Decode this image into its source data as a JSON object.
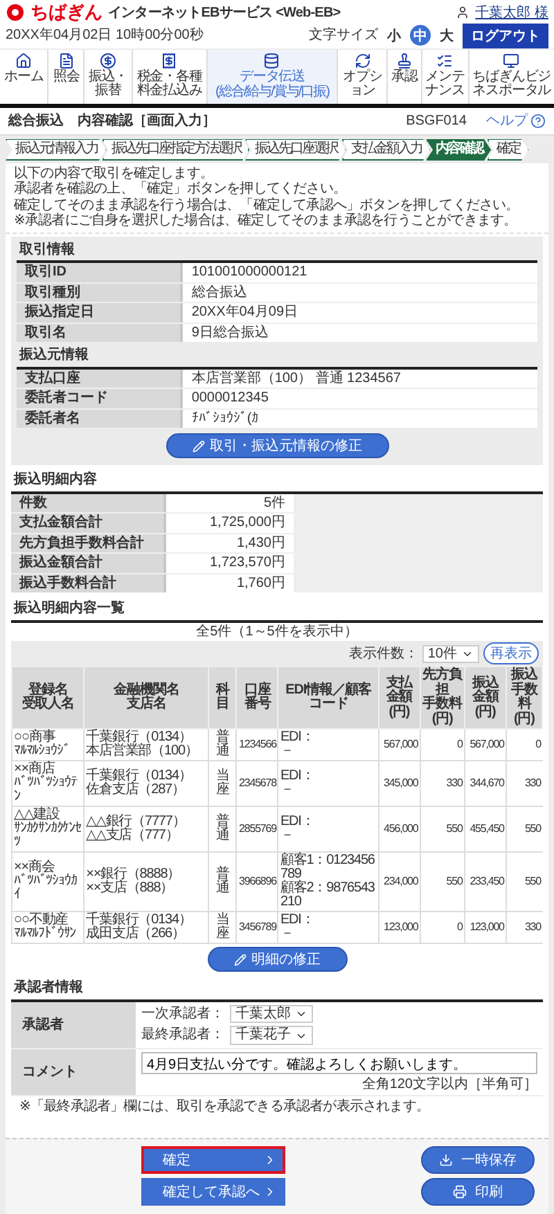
{
  "header": {
    "logo": "ちばぎん",
    "service": "インターネットEBサービス <Web-EB>",
    "user": "千葉太郎 様",
    "datetime": "20XX年04月02日 10時00分00秒",
    "font_size_label": "文字サイズ",
    "font_sizes": [
      {
        "label": "小",
        "selected": false
      },
      {
        "label": "中",
        "selected": true
      },
      {
        "label": "大",
        "selected": false
      }
    ],
    "logout": "ログアウト"
  },
  "nav": [
    {
      "label": "ホーム",
      "selected": false
    },
    {
      "label": "照会",
      "selected": false
    },
    {
      "label": "振込・振替",
      "selected": false
    },
    {
      "label": "税金・各種料金払込み",
      "selected": false
    },
    {
      "label": "データ伝送",
      "sub": "(総合/給与/賞与/口振)",
      "selected": true
    },
    {
      "label": "オプション",
      "selected": false
    },
    {
      "label": "承認",
      "selected": false
    },
    {
      "label": "メンテナンス",
      "selected": false
    },
    {
      "label": "ちばぎんビジネスポータル",
      "selected": false
    }
  ],
  "title_bar": {
    "category": "総合振込",
    "title": "内容確認［画面入力］",
    "screen_id": "BSGF014",
    "help": "ヘルプ"
  },
  "steps": [
    {
      "label": "振込元情報入力",
      "selected": false
    },
    {
      "label": "振込先口座指定方法選択",
      "selected": false
    },
    {
      "label": "振込先口座選択",
      "selected": false
    },
    {
      "label": "支払金額入力",
      "selected": false
    },
    {
      "label": "内容確認",
      "selected": true
    },
    {
      "label": "確定",
      "selected": false
    }
  ],
  "intro": [
    "以下の内容で取引を確定します。",
    "承認者を確認の上、「確定」ボタンを押してください。",
    "確定してそのまま承認を行う場合は、「確定して承認へ」ボタンを押してください。",
    "※承認者にご自身を選択した場合は、確定してそのまま承認を行うことができます。"
  ],
  "transaction_info": {
    "title": "取引情報",
    "rows": [
      {
        "label": "取引ID",
        "value": "101001000000121"
      },
      {
        "label": "取引種別",
        "value": "総合振込"
      },
      {
        "label": "振込指定日",
        "value": "20XX年04月09日"
      },
      {
        "label": "取引名",
        "value": "9日総合振込"
      }
    ]
  },
  "source_info": {
    "title": "振込元情報",
    "rows": [
      {
        "label": "支払口座",
        "value": "本店営業部（100） 普通 1234567"
      },
      {
        "label": "委託者コード",
        "value": "0000012345"
      },
      {
        "label": "委託者名",
        "value": "ﾁﾊﾞｼｮｳｼﾞ(ｶ"
      }
    ],
    "edit_button": "取引・振込元情報の修正"
  },
  "summary": {
    "title": "振込明細内容",
    "rows": [
      {
        "label": "件数",
        "value": "5件"
      },
      {
        "label": "支払金額合計",
        "value": "1,725,000円"
      },
      {
        "label": "先方負担手数料合計",
        "value": "1,430円"
      },
      {
        "label": "振込金額合計",
        "value": "1,723,570円"
      },
      {
        "label": "振込手数料合計",
        "value": "1,760円"
      }
    ]
  },
  "list": {
    "title": "振込明細内容一覧",
    "count": "全5件（1～5件を表示中）",
    "per_page_label": "表示件数：",
    "per_page": "10件",
    "refresh": "再表示",
    "columns": [
      [
        "登録名",
        "受取人名"
      ],
      [
        "金融機関名",
        "支店名"
      ],
      [
        "科目"
      ],
      [
        "口座番号"
      ],
      [
        "EDI情報／顧客コード"
      ],
      [
        "支払金額",
        "(円)"
      ],
      [
        "先方負担",
        "手数料",
        "(円)"
      ],
      [
        "振込金額",
        "(円)"
      ],
      [
        "振込手数",
        "料",
        "(円)"
      ]
    ],
    "rows": [
      {
        "name": [
          "○○商事",
          "ﾏﾙﾏﾙｼｮｳｼﾞ"
        ],
        "bank": [
          "千葉銀行（0134）",
          "本店営業部（100）"
        ],
        "type": "普通",
        "account": "1234566",
        "edi": [
          "EDI：",
          "－"
        ],
        "amount": "567,000",
        "recipient_fee": "0",
        "transfer_amount": "567,000",
        "fee": "0"
      },
      {
        "name": [
          "××商店",
          "ﾊﾞﾂﾊﾞﾂｼｮｳﾃﾝ"
        ],
        "bank": [
          "千葉銀行（0134）",
          "佐倉支店（287）"
        ],
        "type": "当座",
        "account": "2345678",
        "edi": [
          "EDI：",
          "－"
        ],
        "amount": "345,000",
        "recipient_fee": "330",
        "transfer_amount": "344,670",
        "fee": "330"
      },
      {
        "name": [
          "△△建設",
          "ｻﾝｶｸｻﾝｶｸｹﾝｾﾂ"
        ],
        "bank": [
          "△△銀行（7777）",
          "△△支店（777）"
        ],
        "type": "普通",
        "account": "2855769",
        "edi": [
          "EDI：",
          "－"
        ],
        "amount": "456,000",
        "recipient_fee": "550",
        "transfer_amount": "455,450",
        "fee": "550"
      },
      {
        "name": [
          "××商会",
          "ﾊﾞﾂﾊﾞﾂｼｮｳｶｲ"
        ],
        "bank": [
          "××銀行（8888）",
          "××支店（888）"
        ],
        "type": "普通",
        "account": "3966896",
        "edi": [
          "顧客1：0123456789",
          "顧客2：9876543210"
        ],
        "amount": "234,000",
        "recipient_fee": "550",
        "transfer_amount": "233,450",
        "fee": "550"
      },
      {
        "name": [
          "○○不動産",
          "ﾏﾙﾏﾙﾌﾄﾞｳｻﾝ"
        ],
        "bank": [
          "千葉銀行（0134）",
          "成田支店（266）"
        ],
        "type": "当座",
        "account": "3456789",
        "edi": [
          "EDI：",
          "－"
        ],
        "amount": "123,000",
        "recipient_fee": "0",
        "transfer_amount": "123,000",
        "fee": "330"
      }
    ],
    "edit_button": "明細の修正"
  },
  "approver": {
    "title": "承認者情報",
    "label": "承認者",
    "first_label": "一次承認者：",
    "first": "千葉太郎",
    "final_label": "最終承認者：",
    "final": "千葉花子",
    "comment_label": "コメント",
    "comment": "4月9日支払い分です。確認よろしくお願いします。",
    "comment_note": "全角120文字以内［半角可］",
    "footnote": "※「最終承認者」欄には、取引を承認できる承認者が表示されます。"
  },
  "actions": [
    {
      "label": "確定",
      "kind": "primary",
      "highlighted": true
    },
    {
      "label": "確定して承認へ",
      "kind": "primary",
      "highlighted": false
    },
    {
      "label": "一時保存",
      "kind": "save",
      "highlighted": false
    },
    {
      "label": "印刷",
      "kind": "print",
      "highlighted": false
    }
  ]
}
